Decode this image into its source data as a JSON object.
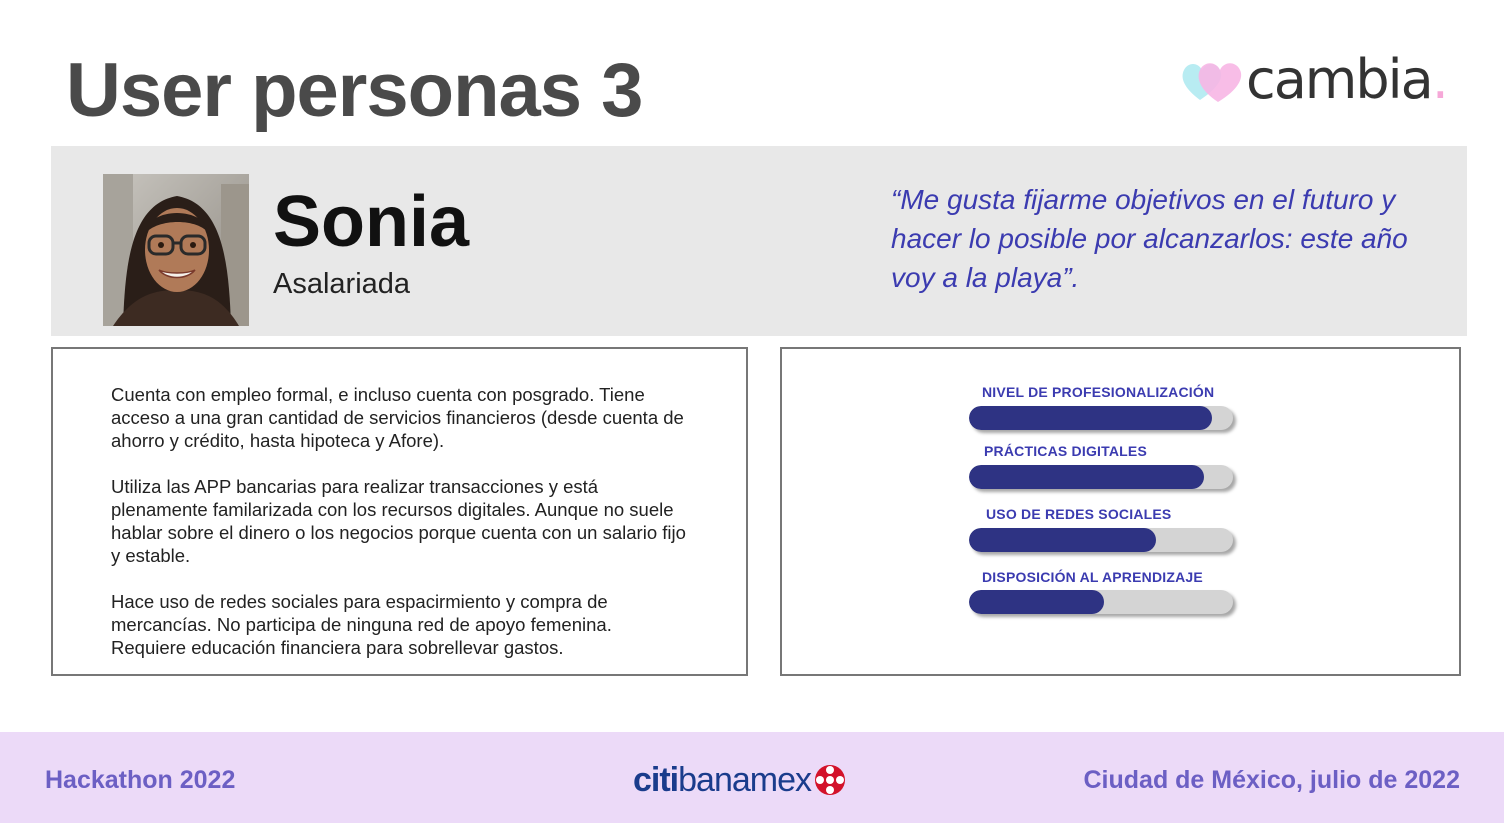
{
  "page": {
    "title": "User personas 3"
  },
  "logo": {
    "text": "cambia",
    "dot": "."
  },
  "persona": {
    "name": "Sonia",
    "role": "Asalariada",
    "quote": "“Me gusta fijarme objetivos en el futuro y hacer lo posible por alcanzarlos: este año voy a la playa”."
  },
  "description": {
    "paragraphs": [
      "Cuenta con empleo formal, e incluso cuenta con posgrado. Tiene acceso a una gran cantidad de servicios financieros (desde cuenta de ahorro y crédito, hasta hipoteca y Afore).",
      "Utiliza las APP bancarias para realizar transacciones y está plenamente familarizada con los recursos digitales. Aunque no suele hablar sobre el dinero o los negocios porque cuenta con un salario fijo y estable.",
      "Hace uso de redes sociales para espacirmiento y compra de mercancías. No participa de ninguna red de apoyo femenina. Requiere educación financiera para sobrellevar gastos."
    ]
  },
  "meters": [
    {
      "label": "NIVEL DE PROFESIONALIZACIÓN",
      "level": 0.92
    },
    {
      "label": "PRÁCTICAS DIGITALES",
      "level": 0.89
    },
    {
      "label": "USO DE REDES SOCIALES",
      "level": 0.71
    },
    {
      "label": "DISPOSICIÓN AL APRENDIZAJE",
      "level": 0.51
    }
  ],
  "footer": {
    "left": "Hackathon 2022",
    "brand_citi": "citi",
    "brand_banamex": "banamex",
    "right": "Ciudad de México, julio de 2022"
  },
  "colors": {
    "accent_text": "#3b3bb0",
    "meter_fill": "#2e3383",
    "meter_track": "#d4d4d4",
    "footer_bg": "#ecdaf8",
    "footer_text": "#6c5fc4"
  },
  "icons": {
    "logo": "hearts-icon",
    "brand": "banamex-emblem-icon"
  }
}
